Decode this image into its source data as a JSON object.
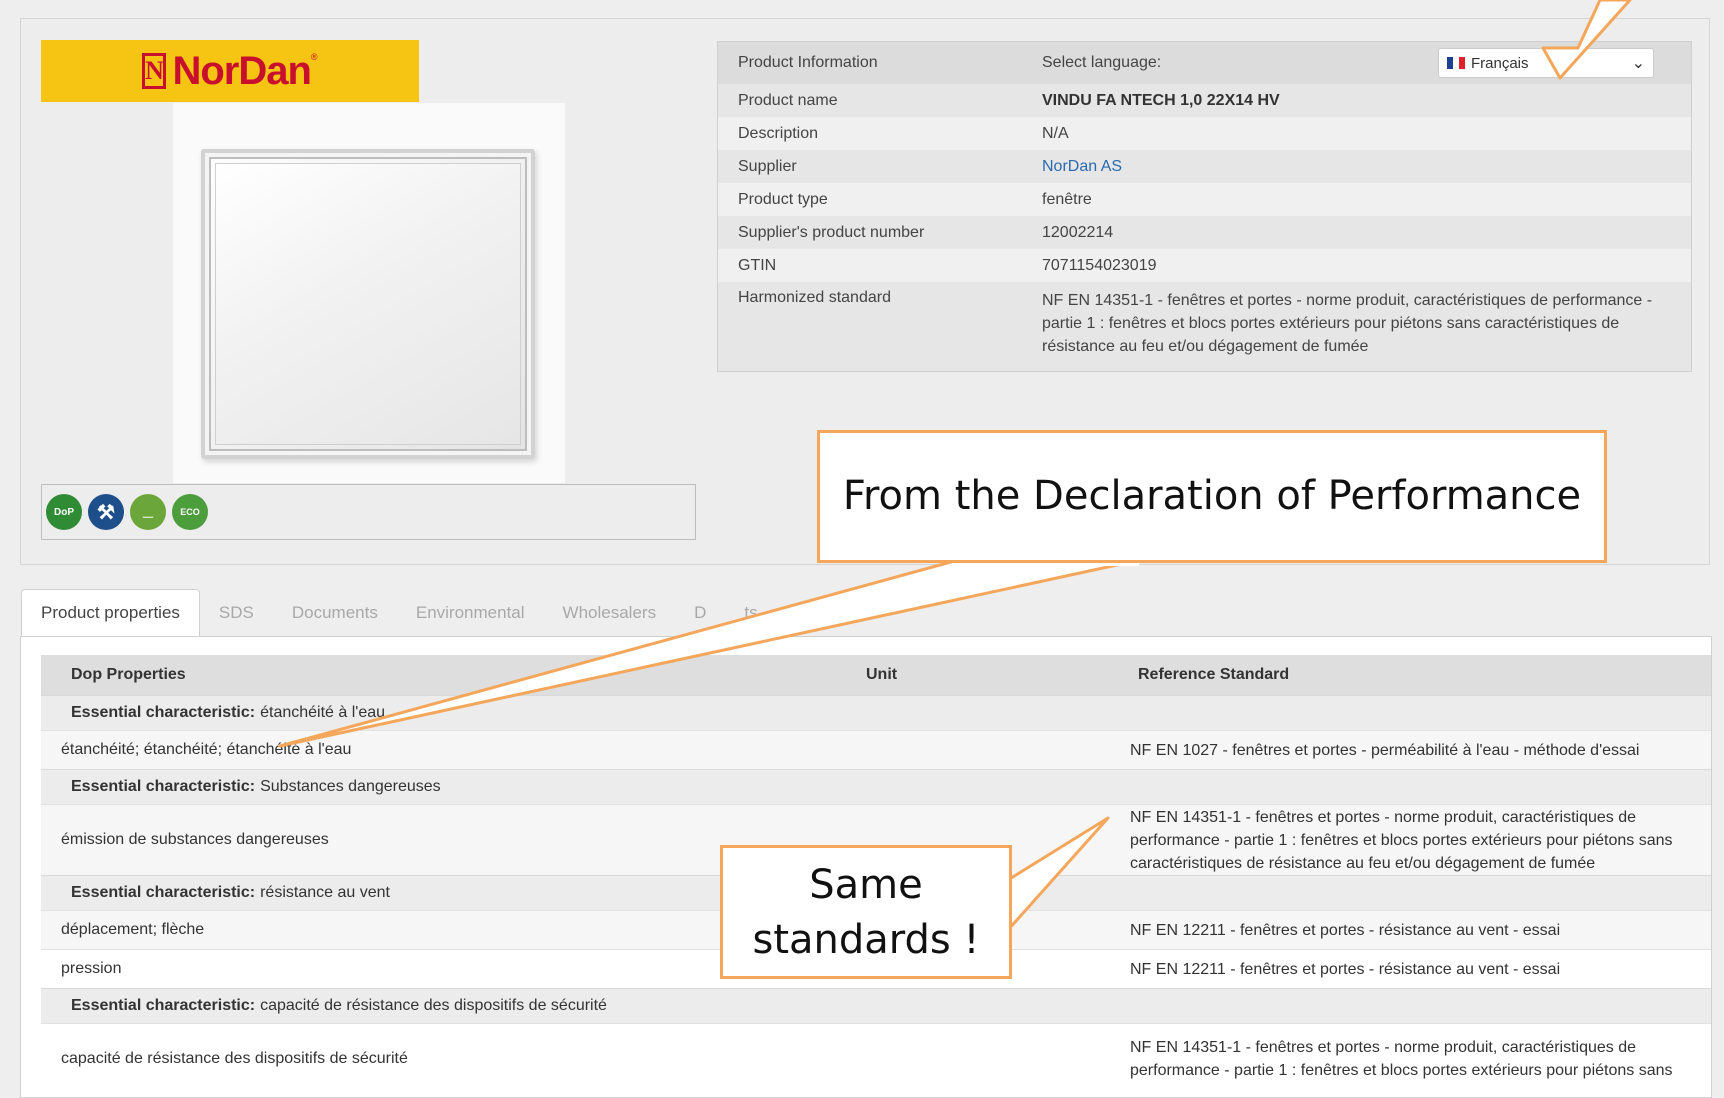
{
  "logo": {
    "brand": "NorDan",
    "mark": "N"
  },
  "badges": [
    {
      "name": "dop-badge",
      "text": "DoP",
      "cls": "dop"
    },
    {
      "name": "tools-badge",
      "text": "",
      "cls": "tools",
      "icon": "tools-icon"
    },
    {
      "name": "swan-badge",
      "text": "",
      "cls": "swan",
      "icon": "swan-icon"
    },
    {
      "name": "eco-badge",
      "text": "ECO",
      "cls": "eco"
    }
  ],
  "info": {
    "header_label": "Product Information",
    "language_label": "Select language:",
    "language_value": "Français",
    "rows": [
      {
        "label": "Product name",
        "value": "VINDU FA NTECH 1,0 22X14 HV",
        "style": "bold"
      },
      {
        "label": "Description",
        "value": "N/A",
        "style": ""
      },
      {
        "label": "Supplier",
        "value": "NorDan AS",
        "style": "link"
      },
      {
        "label": "Product type",
        "value": "fenêtre",
        "style": ""
      },
      {
        "label": "Supplier's product number",
        "value": "12002214",
        "style": ""
      },
      {
        "label": "GTIN",
        "value": "7071154023019",
        "style": ""
      },
      {
        "label": "Harmonized standard",
        "value": "NF EN 14351-1 - fenêtres et portes - norme produit, caractéristiques de performance - partie 1 : fenêtres et blocs portes extérieurs pour piétons sans caractéristiques de résistance au feu et/ou dégagement de fumée",
        "style": ""
      }
    ]
  },
  "tabs": [
    {
      "label": "Product properties",
      "active": true
    },
    {
      "label": "SDS",
      "active": false
    },
    {
      "label": "Documents",
      "active": false
    },
    {
      "label": "Environmental",
      "active": false
    },
    {
      "label": "Wholesalers",
      "active": false
    },
    {
      "label": "D",
      "active": false
    },
    {
      "label": "ts",
      "active": false
    }
  ],
  "properties": {
    "headers": {
      "name": "Dop Properties",
      "unit": "Unit",
      "reference": "Reference Standard"
    },
    "essential_prefix": "Essential characteristic:",
    "sections": [
      {
        "characteristic": "étanchéité à l'eau",
        "rows": [
          {
            "name": "étanchéité; étanchéité; étanchéité à l'eau",
            "reference": "NF EN 1027 - fenêtres et portes - perméabilité à l'eau - méthode d'essai"
          }
        ]
      },
      {
        "characteristic": "Substances dangereuses",
        "rows": [
          {
            "name": "émission de substances dangereuses",
            "reference": "NF EN 14351-1 - fenêtres et portes - norme produit, caractéristiques de performance - partie 1 : fenêtres et blocs portes extérieurs pour piétons sans caractéristiques de résistance au feu et/ou dégagement de fumée"
          }
        ]
      },
      {
        "characteristic": "résistance au vent",
        "rows": [
          {
            "name": "déplacement; flèche",
            "reference": "NF EN 12211 - fenêtres et portes - résistance au vent - essai"
          },
          {
            "name": "pression",
            "reference": "NF EN 12211 - fenêtres et portes - résistance au vent - essai"
          }
        ]
      },
      {
        "characteristic": "capacité de résistance des dispositifs de sécurité",
        "rows": [
          {
            "name": "capacité de résistance des dispositifs de sécurité",
            "reference": "NF EN 14351-1 - fenêtres et portes - norme produit, caractéristiques de performance - partie 1 : fenêtres et blocs portes extérieurs pour piétons sans"
          }
        ]
      }
    ]
  },
  "callouts": {
    "declaration": "From the Declaration of Performance",
    "same_line1": "Same",
    "same_line2": "standards !"
  },
  "colors": {
    "callout_border": "#f4a65b",
    "logo_bg": "#f6c413",
    "brand_red": "#c8102e",
    "link": "#2a6ab0"
  }
}
